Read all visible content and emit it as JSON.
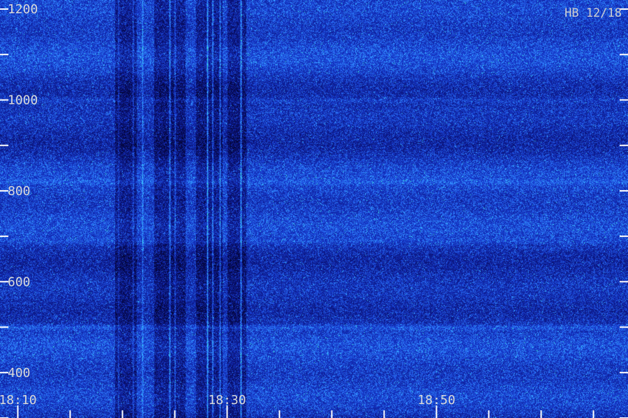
{
  "chart_data": {
    "type": "heatmap",
    "title": "HB 12/18",
    "xlabel": "",
    "ylabel": "",
    "x_tick_labels": [
      "18:10",
      "18:30",
      "18:50"
    ],
    "x_ticks_minutes": [
      10,
      30,
      50
    ],
    "x_range_minutes": [
      8.3,
      68.3
    ],
    "x_minor_step_minutes": 5,
    "y_tick_labels": [
      "400",
      "600",
      "800",
      "1000",
      "1200"
    ],
    "y_ticks": [
      400,
      600,
      800,
      1000,
      1200
    ],
    "y_range": [
      300,
      1220
    ],
    "y_minor_step": 100,
    "horizontal_lines": [
      {
        "y": 1000,
        "intensity": 0.55
      },
      {
        "y": 500,
        "intensity": 0.85
      },
      {
        "y": 690,
        "intensity": 0.4
      },
      {
        "y": 820,
        "intensity": 0.45
      }
    ],
    "vertical_lines_minutes": [
      {
        "x": 24.5,
        "intensity": 0.75
      },
      {
        "x": 25.0,
        "intensity": 0.6
      },
      {
        "x": 28.1,
        "intensity": 0.95
      },
      {
        "x": 28.6,
        "intensity": 0.8
      },
      {
        "x": 29.3,
        "intensity": 0.7
      },
      {
        "x": 31.3,
        "intensity": 0.9
      },
      {
        "x": 21.0,
        "intensity": 0.5
      },
      {
        "x": 21.9,
        "intensity": 0.45
      },
      {
        "x": 19.6,
        "intensity": 0.35
      }
    ],
    "dark_bands_minutes": [
      [
        19.3,
        21.3
      ],
      [
        23.0,
        26.0
      ],
      [
        27.0,
        29.5
      ],
      [
        30.0,
        31.8
      ]
    ],
    "colormap": [
      "#000018",
      "#0a1070",
      "#1535c8",
      "#2f7fff",
      "#3fd8ff",
      "#30ff90"
    ]
  }
}
